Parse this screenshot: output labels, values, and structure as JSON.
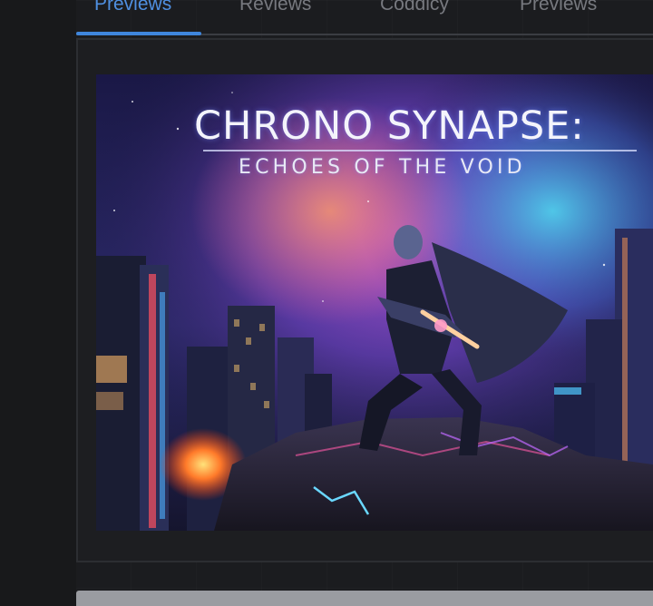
{
  "tabs": [
    {
      "label": "Previews",
      "active": true
    },
    {
      "label": "Reviews",
      "active": false
    },
    {
      "label": "Coddicy",
      "active": false
    },
    {
      "label": "Previews",
      "active": false
    }
  ],
  "preview": {
    "title": "CHRONO SYNAPSE:",
    "subtitle": "ECHOES OF THE VOID"
  },
  "colors": {
    "background": "#1b1c1f",
    "active_tab": "#4f8fe0",
    "inactive_tab": "#77797f",
    "tab_underline": "#3f86dc"
  }
}
